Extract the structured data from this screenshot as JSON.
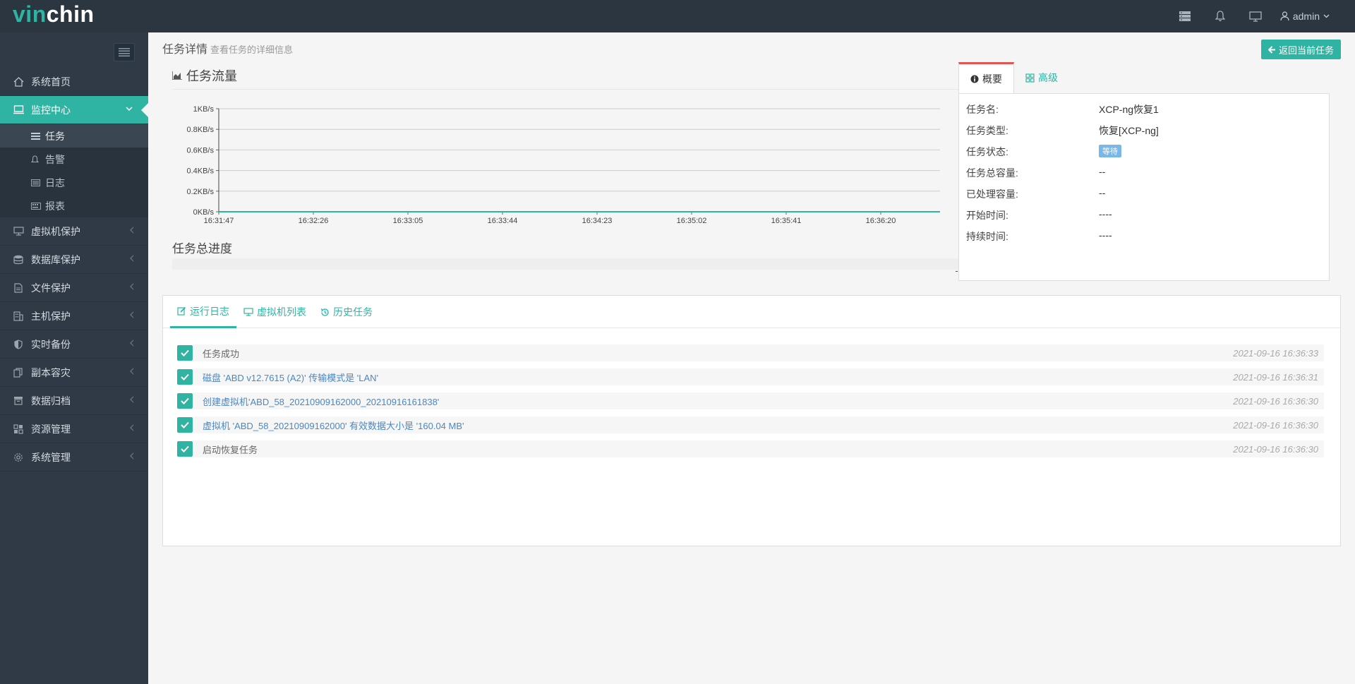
{
  "app": {
    "logo_part1": "vin",
    "logo_part2": "chin"
  },
  "topbar": {
    "user": "admin"
  },
  "sidebar": {
    "items": [
      {
        "label": "系统首页",
        "icon": "home-icon"
      },
      {
        "label": "监控中心",
        "icon": "monitor-icon",
        "active": true
      },
      {
        "label": "虚拟机保护",
        "icon": "desktop-icon"
      },
      {
        "label": "数据库保护",
        "icon": "database-icon"
      },
      {
        "label": "文件保护",
        "icon": "file-icon"
      },
      {
        "label": "主机保护",
        "icon": "building-icon"
      },
      {
        "label": "实时备份",
        "icon": "shield-icon"
      },
      {
        "label": "副本容灾",
        "icon": "copy-icon"
      },
      {
        "label": "数据归档",
        "icon": "archive-icon"
      },
      {
        "label": "资源管理",
        "icon": "grid-icon"
      },
      {
        "label": "系统管理",
        "icon": "gear-icon"
      }
    ],
    "sub_items": [
      {
        "label": "任务",
        "icon": "task-icon",
        "active": true
      },
      {
        "label": "告警",
        "icon": "bell-icon"
      },
      {
        "label": "日志",
        "icon": "log-icon"
      },
      {
        "label": "报表",
        "icon": "report-icon"
      }
    ]
  },
  "page": {
    "title": "任务详情",
    "subtitle": "查看任务的详细信息",
    "back_button": "返回当前任务"
  },
  "flow": {
    "title": "任务流量",
    "progress_title": "任务总进度",
    "progress_value": "--"
  },
  "chart_data": {
    "type": "line",
    "title": "",
    "xlabel": "",
    "ylabel": "",
    "y_ticks": [
      "0KB/s",
      "0.2KB/s",
      "0.4KB/s",
      "0.6KB/s",
      "0.8KB/s",
      "1KB/s"
    ],
    "x_ticks": [
      "16:31:47",
      "16:32:26",
      "16:33:05",
      "16:33:44",
      "16:34:23",
      "16:35:02",
      "16:35:41",
      "16:36:20"
    ],
    "ylim": [
      0,
      1
    ],
    "series": [
      {
        "values": [
          0,
          0,
          0,
          0,
          0,
          0,
          0,
          0,
          0
        ]
      }
    ],
    "grid": true,
    "line_color": "#2fb4a3"
  },
  "info": {
    "tabs": [
      "概要",
      "高级"
    ],
    "rows": [
      {
        "key": "任务名:",
        "value": "XCP-ng恢复1"
      },
      {
        "key": "任务类型:",
        "value": "恢复[XCP-ng]"
      },
      {
        "key": "任务状态:",
        "value": "等待"
      },
      {
        "key": "任务总容量:",
        "value": "--"
      },
      {
        "key": "已处理容量:",
        "value": "--"
      },
      {
        "key": "开始时间:",
        "value": "----"
      },
      {
        "key": "持续时间:",
        "value": "----"
      }
    ]
  },
  "log": {
    "tabs": [
      "运行日志",
      "虚拟机列表",
      "历史任务"
    ],
    "items": [
      {
        "text": "任务成功",
        "time": "2021-09-16 16:36:33",
        "highlight": false
      },
      {
        "text": "磁盘 'ABD v12.7615 (A2)' 传输模式是 'LAN'",
        "time": "2021-09-16 16:36:31",
        "highlight": true
      },
      {
        "text": "创建虚拟机'ABD_58_20210909162000_20210916161838'",
        "time": "2021-09-16 16:36:30",
        "highlight": true
      },
      {
        "text": "虚拟机 'ABD_58_20210909162000' 有效数据大小是 '160.04 MB'",
        "time": "2021-09-16 16:36:30",
        "highlight": true
      },
      {
        "text": "启动恢复任务",
        "time": "2021-09-16 16:36:30",
        "highlight": false
      }
    ]
  },
  "colors": {
    "accent": "#2fb4a3",
    "sidebar": "#2f3a46",
    "topbar": "#2b3641",
    "badge": "#79b7e8"
  }
}
